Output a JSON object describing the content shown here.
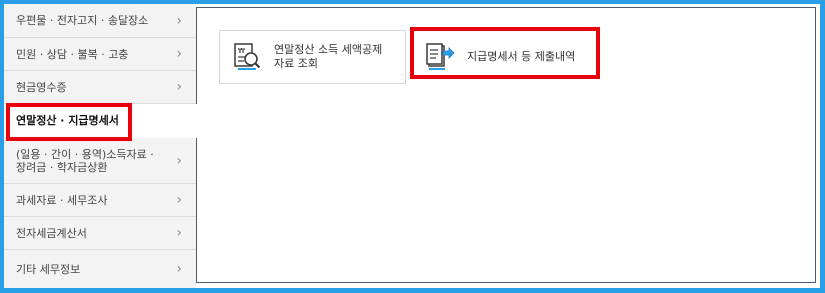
{
  "sidebar": {
    "items": [
      {
        "label": "우편물 · 전자고지 · 송달장소"
      },
      {
        "label": "민원 · 상담 · 불복 · 고충"
      },
      {
        "label": "현금영수증"
      },
      {
        "label": "연말정산 · 지급명세서"
      },
      {
        "label_line1": "(일용 · 간이 · 용역)소득자료 ·",
        "label_line2": "장려금 · 학자금상환"
      },
      {
        "label": "과세자료 · 세무조사"
      },
      {
        "label": "전자세금계산서"
      },
      {
        "label": "기타 세무정보"
      }
    ],
    "chevron": "›"
  },
  "main": {
    "cards": [
      {
        "label_line1": "연말정산 소득 세액공제",
        "label_line2": "자료 조회",
        "icon": "document-search-icon"
      },
      {
        "label": "지급명세서 등 제출내역",
        "icon": "document-submit-icon"
      }
    ]
  },
  "colors": {
    "background": "#2a9ee6",
    "highlight": "#e8000b",
    "sidebar": "#f3f3f3",
    "content_border": "#4a5b73"
  }
}
